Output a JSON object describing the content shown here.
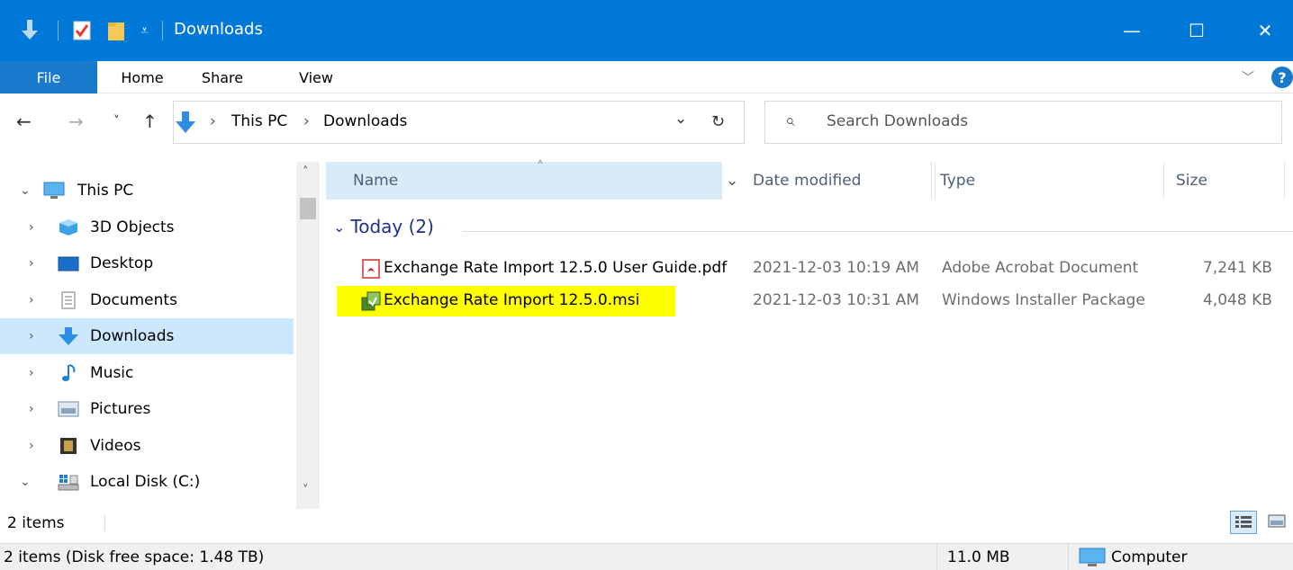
{
  "window": {
    "title": "Downloads",
    "minimize_glyph": "—",
    "maximize_glyph": "☐",
    "close_glyph": "✕"
  },
  "ribbon": {
    "tabs": [
      "File",
      "Home",
      "Share",
      "View"
    ],
    "collapse_glyph": "﹀",
    "help_glyph": "?"
  },
  "address": {
    "back_glyph": "←",
    "forward_glyph": "→",
    "recent_glyph": "˅",
    "up_glyph": "↑",
    "path": [
      "This PC",
      "Downloads"
    ],
    "separator": "›",
    "dropdown_glyph": "⌄",
    "refresh_glyph": "↻",
    "search_placeholder": "Search Downloads",
    "search_glyph": "⌕"
  },
  "nav": {
    "items": [
      {
        "label": "This PC",
        "icon": "computer-icon",
        "chevron": "⌄"
      },
      {
        "label": "3D Objects",
        "icon": "cube-icon",
        "chevron": "›"
      },
      {
        "label": "Desktop",
        "icon": "desktop-icon",
        "chevron": "›"
      },
      {
        "label": "Documents",
        "icon": "document-icon",
        "chevron": "›"
      },
      {
        "label": "Downloads",
        "icon": "download-arrow-icon",
        "chevron": "›"
      },
      {
        "label": "Music",
        "icon": "music-note-icon",
        "chevron": "›"
      },
      {
        "label": "Pictures",
        "icon": "pictures-icon",
        "chevron": "›"
      },
      {
        "label": "Videos",
        "icon": "film-icon",
        "chevron": "›"
      },
      {
        "label": "Local Disk (C:)",
        "icon": "drive-icon",
        "chevron": "⌄"
      }
    ],
    "selected": "Downloads",
    "scroll_up": "˄",
    "scroll_down": "˅"
  },
  "columns": {
    "name": "Name",
    "date": "Date modified",
    "type": "Type",
    "size": "Size",
    "sort_glyph": "˄",
    "dropdown_glyph": "⌄"
  },
  "group": {
    "label": "Today (2)",
    "collapse_glyph": "⌄"
  },
  "files": [
    {
      "name": "Exchange Rate Import 12.5.0 User Guide.pdf",
      "date": "2021-12-03 10:19 AM",
      "type": "Adobe Acrobat Document",
      "size": "7,241 KB",
      "icon": "pdf-icon",
      "highlighted": false
    },
    {
      "name": "Exchange Rate Import 12.5.0.msi",
      "date": "2021-12-03 10:31 AM",
      "type": "Windows Installer Package",
      "size": "4,048 KB",
      "icon": "installer-icon",
      "highlighted": true
    }
  ],
  "status": {
    "item_count": "2 items",
    "disk_info": "2 items (Disk free space: 1.48 TB)",
    "total_size": "11.0 MB",
    "location": "Computer"
  },
  "colors": {
    "titlebar": "#0078d7",
    "file_tab": "#1979ca",
    "selected_nav": "#cce8ff",
    "highlight": "#ffff00",
    "group_text": "#1e3287"
  }
}
